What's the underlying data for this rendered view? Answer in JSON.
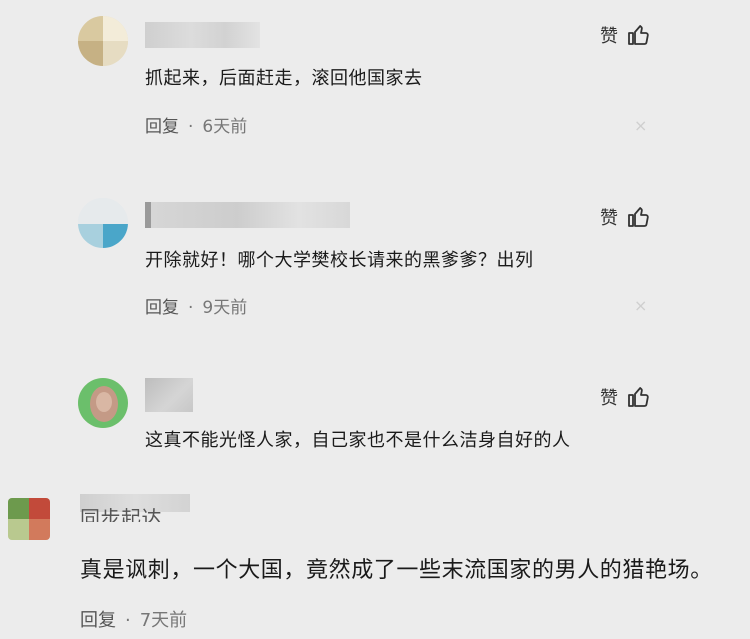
{
  "comments": [
    {
      "text": "抓起来，后面赶走，滚回他国家去",
      "reply_label": "回复",
      "time": "6天前",
      "like_label": "赞",
      "avatar_colors": [
        "#e8dcc0",
        "#c9b98e",
        "#f1ead7"
      ],
      "close_glyph": "×"
    },
    {
      "text": "开除就好！哪个大学樊校长请来的黑爹爹？出列",
      "reply_label": "回复",
      "time": "9天前",
      "like_label": "赞",
      "avatar_colors": [
        "#dfe6ea",
        "#8fc4d8",
        "#4aa6c9"
      ],
      "close_glyph": "×"
    },
    {
      "text": "这真不能光怪人家，自己家也不是什么洁身自好的人",
      "reply_label": "",
      "time": "",
      "like_label": "赞",
      "avatar_colors": [
        "#6bbf6b",
        "#c49a86",
        "#e8e0d5"
      ],
      "close_glyph": ""
    },
    {
      "username_partial": "同步起达",
      "text": "真是讽刺，一个大国，竟然成了一些末流国家的男人的猎艳场。",
      "reply_label": "回复",
      "time": "7天前",
      "like_label": "",
      "avatar_colors": [
        "#c24a3a",
        "#6d9a4d",
        "#e5d9c8"
      ],
      "close_glyph": ""
    }
  ],
  "icons": {
    "like": "thumbs-up-icon",
    "close": "close-icon"
  },
  "colors": {
    "background": "#ececec",
    "text": "#1a1a1a",
    "meta": "#777777"
  }
}
